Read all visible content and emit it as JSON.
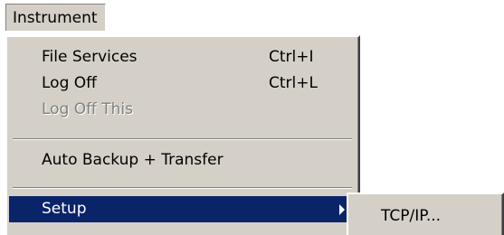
{
  "menubar": {
    "instrument_label": "Instrument"
  },
  "menu": {
    "items": [
      {
        "label": "File Services",
        "shortcut": "Ctrl+I",
        "enabled": true
      },
      {
        "label": "Log Off",
        "shortcut": "Ctrl+L",
        "enabled": true
      },
      {
        "label": "Log Off This",
        "shortcut": "",
        "enabled": false
      },
      {
        "label": "Auto Backup + Transfer",
        "shortcut": "",
        "enabled": true
      },
      {
        "label": "Setup",
        "shortcut": "",
        "enabled": true,
        "highlighted": true,
        "has_submenu": true
      }
    ]
  },
  "submenu": {
    "items": [
      {
        "label": "TCP/IP..."
      }
    ]
  },
  "colors": {
    "menu_background": "#d4d0c8",
    "highlight_background": "#0a246a",
    "highlight_text": "#ffffff",
    "disabled_text": "#808080"
  }
}
